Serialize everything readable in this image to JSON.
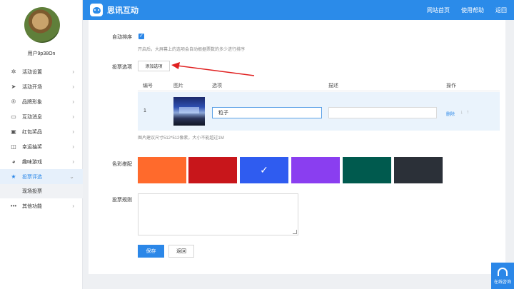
{
  "app": {
    "title": "思讯互动"
  },
  "header": {
    "nav": [
      "网站首页",
      "使用帮助",
      "返回"
    ]
  },
  "user": {
    "name": "用户9p38On"
  },
  "sidebar": {
    "items": [
      {
        "label": "活动设置",
        "icon": "gear-icon"
      },
      {
        "label": "活动开场",
        "icon": "send-icon"
      },
      {
        "label": "品牌形象",
        "icon": "registered-icon"
      },
      {
        "label": "互动消息",
        "icon": "message-icon"
      },
      {
        "label": "红包奖品",
        "icon": "gift-icon"
      },
      {
        "label": "幸运抽奖",
        "icon": "lottery-icon"
      },
      {
        "label": "趣味游戏",
        "icon": "game-icon"
      },
      {
        "label": "投票评选",
        "icon": "star-icon"
      },
      {
        "label": "其他功能",
        "icon": "more-icon"
      }
    ],
    "active_sub": "现场投票"
  },
  "form": {
    "auto_sort_label": "自动排序",
    "auto_sort_checked": true,
    "auto_sort_hint": "开启后，大屏幕上的选项会自动根据票数的多少进行排序",
    "options_label": "投票选项",
    "add_option": "添加选项",
    "table": {
      "headers": [
        "编号",
        "图片",
        "选项",
        "描述",
        "操作"
      ],
      "rows": [
        {
          "no": "1",
          "name": "粒子",
          "desc": "",
          "delete": "删除",
          "arrows": "↓↑"
        }
      ]
    },
    "image_hint": "图片建议尺寸512*512像素，大小不能超过1M",
    "color_label": "色彩搭配",
    "colors": [
      "#ff6a2c",
      "#c8161b",
      "#2f5cf0",
      "#8a3ef0",
      "#005a4e",
      "#2b3038"
    ],
    "selected_color_index": 2,
    "rules_label": "投票规则",
    "rules_value": "",
    "save": "保存",
    "back": "返回"
  },
  "help_float": {
    "label": "在线咨询"
  }
}
